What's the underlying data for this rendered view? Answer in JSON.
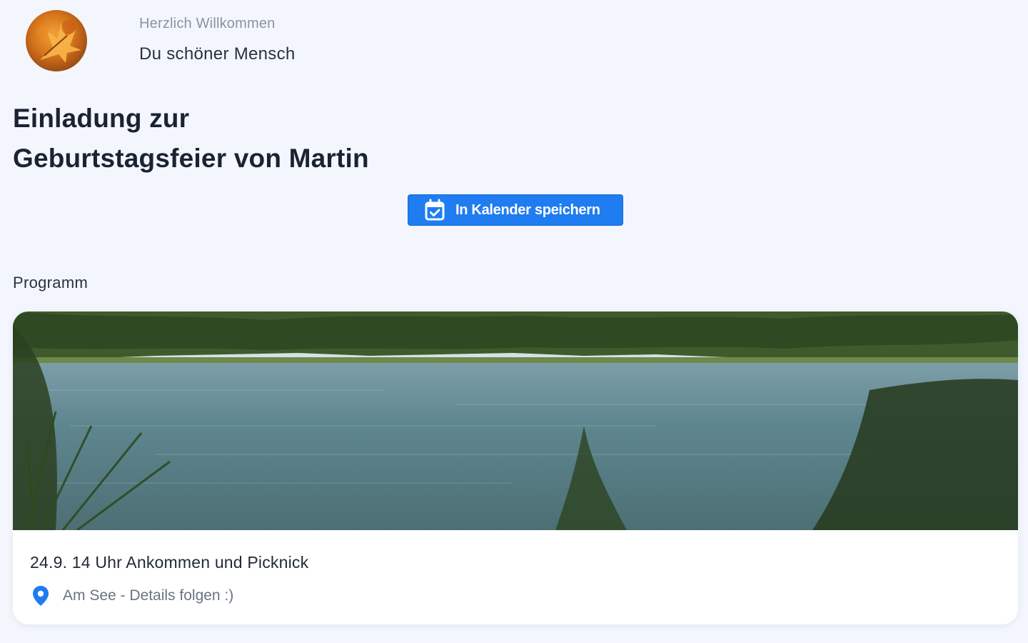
{
  "header": {
    "greeting_sub": "Herzlich Willkommen",
    "greeting_main": "Du schöner Mensch",
    "avatar_icon": "autumn-leaf-avatar"
  },
  "invitation": {
    "title_line1": "Einladung zur",
    "title_line2": "Geburtstagsfeier von Martin"
  },
  "calendar_button": {
    "label": "In Kalender speichern",
    "icon": "calendar-check-icon",
    "color": "#1f7cf1"
  },
  "program": {
    "section_label": "Programm",
    "items": [
      {
        "event": "24.9. 14 Uhr Ankommen und Picknick",
        "location": "Am See - Details folgen :)",
        "location_icon": "map-pin-icon",
        "image": "lake-photo"
      }
    ]
  }
}
